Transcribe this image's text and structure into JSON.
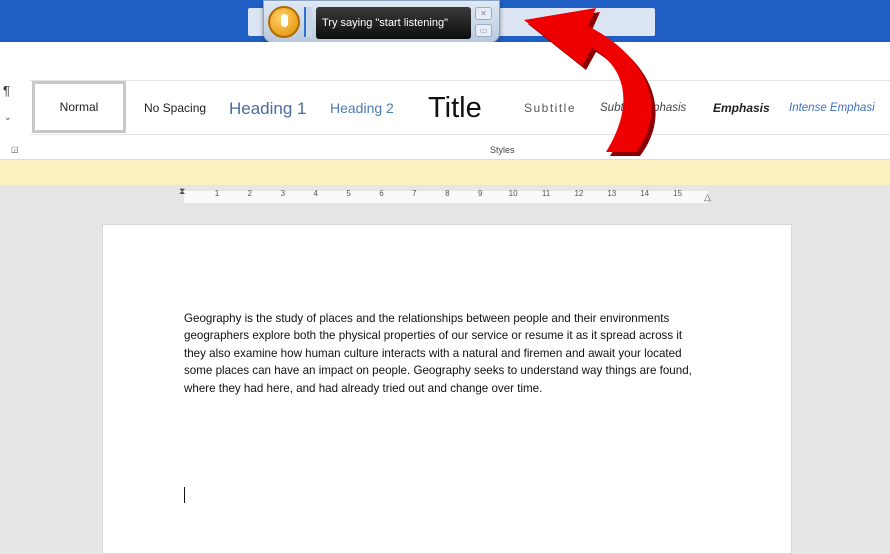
{
  "speech": {
    "prompt": "Try saying \"start listening\"",
    "close_icon": "close-icon",
    "minimize_icon": "minimize-icon",
    "mic_icon": "microphone-icon"
  },
  "ribbon": {
    "styles": [
      "Normal",
      "No Spacing",
      "Heading 1",
      "Heading 2",
      "Title",
      "Subtitle",
      "Subtle Emphasis",
      "Emphasis",
      "Intense Emphasi"
    ],
    "group_label": "Styles",
    "pilcrow": "¶"
  },
  "ruler": {
    "numbers": [
      "1",
      "2",
      "3",
      "4",
      "5",
      "6",
      "7",
      "8",
      "9",
      "10",
      "11",
      "12",
      "13",
      "14",
      "15"
    ]
  },
  "document": {
    "lines": [
      "Geography is the study of places and the relationships between people and their environments",
      "geographers explore both the physical properties of our service or resume it as it spread across it",
      "they also examine how human culture interacts with a natural and firemen and await your located",
      "some places can have an impact on people.  Geography seeks to understand way things are found,",
      "where they had here, and had already tried out and change over time."
    ]
  },
  "annotation": {
    "arrow_color": "#ee0000"
  },
  "colors": {
    "titlebar": "#1f5fc4",
    "message_bar": "#fbf1c0"
  }
}
